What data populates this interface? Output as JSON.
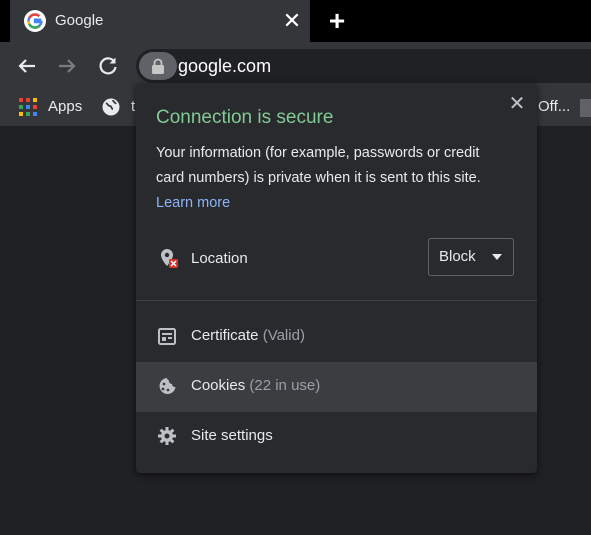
{
  "tab": {
    "title": "Google",
    "close": "✕",
    "new_tab": "+"
  },
  "omnibox": {
    "url": "google.com"
  },
  "bookmarks": {
    "apps_label": "Apps",
    "item2_label": "t",
    "item3_label": "Off..."
  },
  "popup": {
    "close": "✕",
    "title": "Connection is secure",
    "description": "Your information (for example, passwords or credit card numbers) is private when it is sent to this site.",
    "learn_more": "Learn more",
    "location": {
      "label": "Location",
      "value": "Block"
    },
    "certificate": {
      "label": "Certificate",
      "status": "(Valid)"
    },
    "cookies": {
      "label": "Cookies",
      "status": "(22 in use)"
    },
    "site_settings": {
      "label": "Site settings"
    }
  },
  "colors": {
    "secure_green": "#81c995",
    "link_blue": "#8ab4f8",
    "toolbar": "#35363a",
    "popup_bg": "#292a2d"
  }
}
